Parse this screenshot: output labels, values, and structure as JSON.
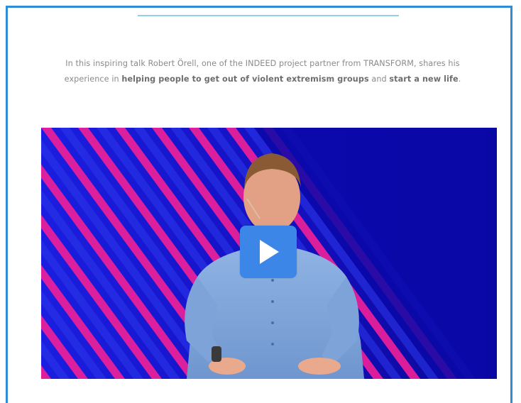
{
  "intro": {
    "part1": "In this inspiring talk Robert Örell, one of the INDEED project partner from TRANSFORM, shares his experience in ",
    "bold1": "helping people to get out of violent extremism groups",
    "part2": " and ",
    "bold2": "start a new life",
    "part3": "."
  },
  "video": {
    "play_icon": "play-icon",
    "accent_stripe_color": "#e6209a",
    "stripe_alt_color": "#2a36e8",
    "background_color": "#0b08a8",
    "play_button_color": "#3b86e6"
  },
  "colors": {
    "frame_border": "#2f8ed3",
    "divider": "#8fd3e3"
  }
}
